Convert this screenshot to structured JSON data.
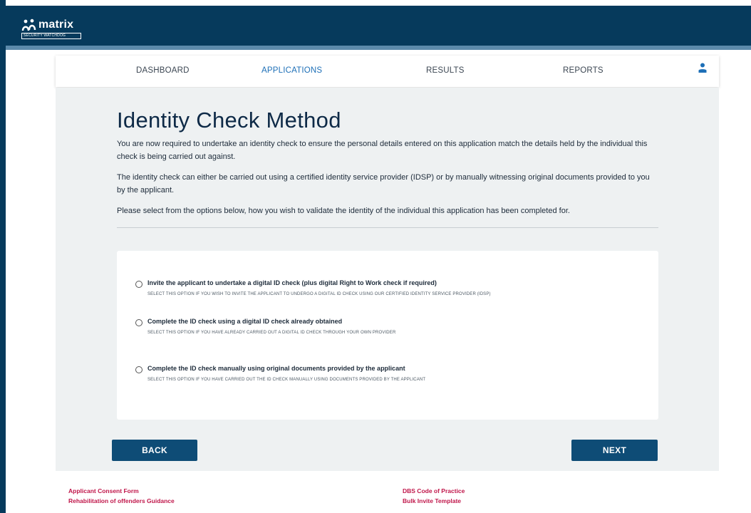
{
  "brand": {
    "name": "matrix",
    "tagline": "SECURITY WATCHDOG",
    "colors": {
      "header": "#063a5c",
      "accent": "#1d6fb7",
      "button": "#0e4c76",
      "link": "#c0164a"
    }
  },
  "nav": {
    "items": [
      {
        "label": "DASHBOARD",
        "active": false
      },
      {
        "label": "APPLICATIONS",
        "active": true
      },
      {
        "label": "RESULTS",
        "active": false
      },
      {
        "label": "REPORTS",
        "active": false
      }
    ],
    "user_icon": "user-icon"
  },
  "main": {
    "title": "Identity Check Method",
    "paragraphs": [
      "You are now required to undertake an identity check to ensure the personal details entered on this application match the details held by the individual this check is being carried out against.",
      "The identity check can either be carried out using a certified identity service provider (IDSP) or by manually witnessing original documents provided to you by the applicant.",
      "Please select from the options below, how you wish to validate the identity of the individual this application has been completed for."
    ],
    "options": [
      {
        "label": "Invite the applicant to undertake a digital ID check (plus digital Right to Work check if required)",
        "sub": "SELECT THIS OPTION IF YOU WISH TO INVITE THE APPLICANT TO UNDERGO A DIGITAL ID CHECK USING OUR CERTIFIED IDENTITY SERVICE PROVIDER (IDSP)",
        "selected": false
      },
      {
        "label": "Complete the ID check using a digital ID check already obtained",
        "sub": "SELECT THIS OPTION IF YOU HAVE ALREADY CARRIED OUT A DIGITAL ID CHECK THROUGH YOUR OWN PROVIDER",
        "selected": false
      },
      {
        "label": "Complete the ID check manually using original documents provided by the applicant",
        "sub": "SELECT THIS OPTION IF YOU HAVE CARRIED OUT THE ID CHECK MANUALLY USING DOCUMENTS PROVIDED BY THE APPLICANT",
        "selected": false
      }
    ],
    "back_label": "BACK",
    "next_label": "NEXT"
  },
  "footer": {
    "links": [
      "Applicant Consent Form",
      "Rehabilitation of offenders Guidance",
      "DBS Code of Practice",
      "Bulk Invite Template"
    ]
  }
}
